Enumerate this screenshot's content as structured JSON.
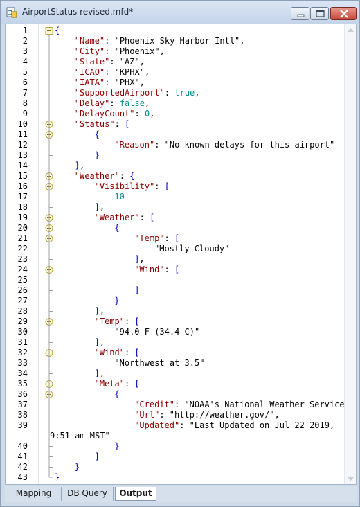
{
  "window": {
    "title": "AirportStatus revised.mfd*",
    "icon": "mapping-file-icon"
  },
  "editor": {
    "lines": [
      {
        "n": "1",
        "tokens": [
          [
            "p",
            "{"
          ]
        ]
      },
      {
        "n": "2",
        "tokens": [
          [
            "k",
            "\"Name\""
          ],
          [
            "c",
            ": "
          ],
          [
            "s",
            "\"Phoenix Sky Harbor Intl\""
          ],
          [
            "c",
            ","
          ]
        ]
      },
      {
        "n": "3",
        "tokens": [
          [
            "k",
            "\"City\""
          ],
          [
            "c",
            ": "
          ],
          [
            "s",
            "\"Phoenix\""
          ],
          [
            "c",
            ","
          ]
        ]
      },
      {
        "n": "4",
        "tokens": [
          [
            "k",
            "\"State\""
          ],
          [
            "c",
            ": "
          ],
          [
            "s",
            "\"AZ\""
          ],
          [
            "c",
            ","
          ]
        ]
      },
      {
        "n": "5",
        "tokens": [
          [
            "k",
            "\"ICAO\""
          ],
          [
            "c",
            ": "
          ],
          [
            "s",
            "\"KPHX\""
          ],
          [
            "c",
            ","
          ]
        ]
      },
      {
        "n": "6",
        "tokens": [
          [
            "k",
            "\"IATA\""
          ],
          [
            "c",
            ": "
          ],
          [
            "s",
            "\"PHX\""
          ],
          [
            "c",
            ","
          ]
        ]
      },
      {
        "n": "7",
        "tokens": [
          [
            "k",
            "\"SupportedAirport\""
          ],
          [
            "c",
            ": "
          ],
          [
            "n",
            "true"
          ],
          [
            "c",
            ","
          ]
        ]
      },
      {
        "n": "8",
        "tokens": [
          [
            "k",
            "\"Delay\""
          ],
          [
            "c",
            ": "
          ],
          [
            "n",
            "false"
          ],
          [
            "c",
            ","
          ]
        ]
      },
      {
        "n": "9",
        "tokens": [
          [
            "k",
            "\"DelayCount\""
          ],
          [
            "c",
            ": "
          ],
          [
            "n",
            "0"
          ],
          [
            "c",
            ","
          ]
        ]
      },
      {
        "n": "10",
        "tokens": [
          [
            "k",
            "\"Status\""
          ],
          [
            "c",
            ": "
          ],
          [
            "p",
            "["
          ]
        ]
      },
      {
        "n": "11",
        "tokens": [
          [
            "p",
            "{"
          ]
        ]
      },
      {
        "n": "12",
        "tokens": [
          [
            "k",
            "\"Reason\""
          ],
          [
            "c",
            ": "
          ],
          [
            "s",
            "\"No known delays for this airport\""
          ]
        ]
      },
      {
        "n": "13",
        "tokens": [
          [
            "p",
            "}"
          ]
        ]
      },
      {
        "n": "14",
        "tokens": [
          [
            "p",
            "]"
          ],
          [
            "c",
            ","
          ]
        ]
      },
      {
        "n": "15",
        "tokens": [
          [
            "k",
            "\"Weather\""
          ],
          [
            "c",
            ": "
          ],
          [
            "p",
            "{"
          ]
        ]
      },
      {
        "n": "16",
        "tokens": [
          [
            "k",
            "\"Visibility\""
          ],
          [
            "c",
            ": "
          ],
          [
            "p",
            "["
          ]
        ]
      },
      {
        "n": "17",
        "tokens": [
          [
            "n",
            "10"
          ]
        ]
      },
      {
        "n": "18",
        "tokens": [
          [
            "p",
            "]"
          ],
          [
            "c",
            ","
          ]
        ]
      },
      {
        "n": "19",
        "tokens": [
          [
            "k",
            "\"Weather\""
          ],
          [
            "c",
            ": "
          ],
          [
            "p",
            "["
          ]
        ]
      },
      {
        "n": "20",
        "tokens": [
          [
            "p",
            "{"
          ]
        ]
      },
      {
        "n": "21",
        "tokens": [
          [
            "k",
            "\"Temp\""
          ],
          [
            "c",
            ": "
          ],
          [
            "p",
            "["
          ]
        ]
      },
      {
        "n": "22",
        "tokens": [
          [
            "s",
            "\"Mostly Cloudy\""
          ]
        ]
      },
      {
        "n": "23",
        "tokens": [
          [
            "p",
            "]"
          ],
          [
            "c",
            ","
          ]
        ]
      },
      {
        "n": "24",
        "tokens": [
          [
            "k",
            "\"Wind\""
          ],
          [
            "c",
            ": "
          ],
          [
            "p",
            "["
          ]
        ]
      },
      {
        "n": "25",
        "tokens": []
      },
      {
        "n": "26",
        "tokens": [
          [
            "p",
            "]"
          ]
        ]
      },
      {
        "n": "27",
        "tokens": [
          [
            "p",
            "}"
          ]
        ]
      },
      {
        "n": "28",
        "tokens": [
          [
            "p",
            "]"
          ],
          [
            "c",
            ","
          ]
        ]
      },
      {
        "n": "29",
        "tokens": [
          [
            "k",
            "\"Temp\""
          ],
          [
            "c",
            ": "
          ],
          [
            "p",
            "["
          ]
        ]
      },
      {
        "n": "30",
        "tokens": [
          [
            "s",
            "\"94.0 F (34.4 C)\""
          ]
        ]
      },
      {
        "n": "31",
        "tokens": [
          [
            "p",
            "]"
          ],
          [
            "c",
            ","
          ]
        ]
      },
      {
        "n": "32",
        "tokens": [
          [
            "k",
            "\"Wind\""
          ],
          [
            "c",
            ": "
          ],
          [
            "p",
            "["
          ]
        ]
      },
      {
        "n": "33",
        "tokens": [
          [
            "s",
            "\"Northwest at 3.5\""
          ]
        ]
      },
      {
        "n": "34",
        "tokens": [
          [
            "p",
            "]"
          ],
          [
            "c",
            ","
          ]
        ]
      },
      {
        "n": "35",
        "tokens": [
          [
            "k",
            "\"Meta\""
          ],
          [
            "c",
            ": "
          ],
          [
            "p",
            "["
          ]
        ]
      },
      {
        "n": "36",
        "tokens": [
          [
            "p",
            "{"
          ]
        ]
      },
      {
        "n": "37",
        "tokens": [
          [
            "k",
            "\"Credit\""
          ],
          [
            "c",
            ": "
          ],
          [
            "s",
            "\"NOAA's National Weather Service\""
          ],
          [
            "c",
            ","
          ]
        ]
      },
      {
        "n": "38",
        "tokens": [
          [
            "k",
            "\"Url\""
          ],
          [
            "c",
            ": "
          ],
          [
            "s",
            "\"http://weather.gov/\""
          ],
          [
            "c",
            ","
          ]
        ]
      },
      {
        "n": "39",
        "tokens": [
          [
            "k",
            "\"Updated\""
          ],
          [
            "c",
            ": "
          ],
          [
            "s",
            "\"Last Updated on Jul 22 2019,"
          ]
        ]
      },
      {
        "n": "",
        "tokens": [
          [
            "s",
            "9:51 am MST\""
          ]
        ]
      },
      {
        "n": "40",
        "tokens": [
          [
            "p",
            "}"
          ]
        ]
      },
      {
        "n": "41",
        "tokens": [
          [
            "p",
            "]"
          ]
        ]
      },
      {
        "n": "42",
        "tokens": [
          [
            "p",
            "}"
          ]
        ]
      },
      {
        "n": "43",
        "tokens": [
          [
            "p",
            "}"
          ]
        ]
      }
    ]
  },
  "tabs": [
    {
      "label": "Mapping",
      "active": false
    },
    {
      "label": "DB Query",
      "active": false
    },
    {
      "label": "Output",
      "active": true
    }
  ],
  "colors": {
    "key": "#8b0000",
    "number": "#009090",
    "bracket": "#0000c0",
    "fold_marker": "#b8a640"
  }
}
